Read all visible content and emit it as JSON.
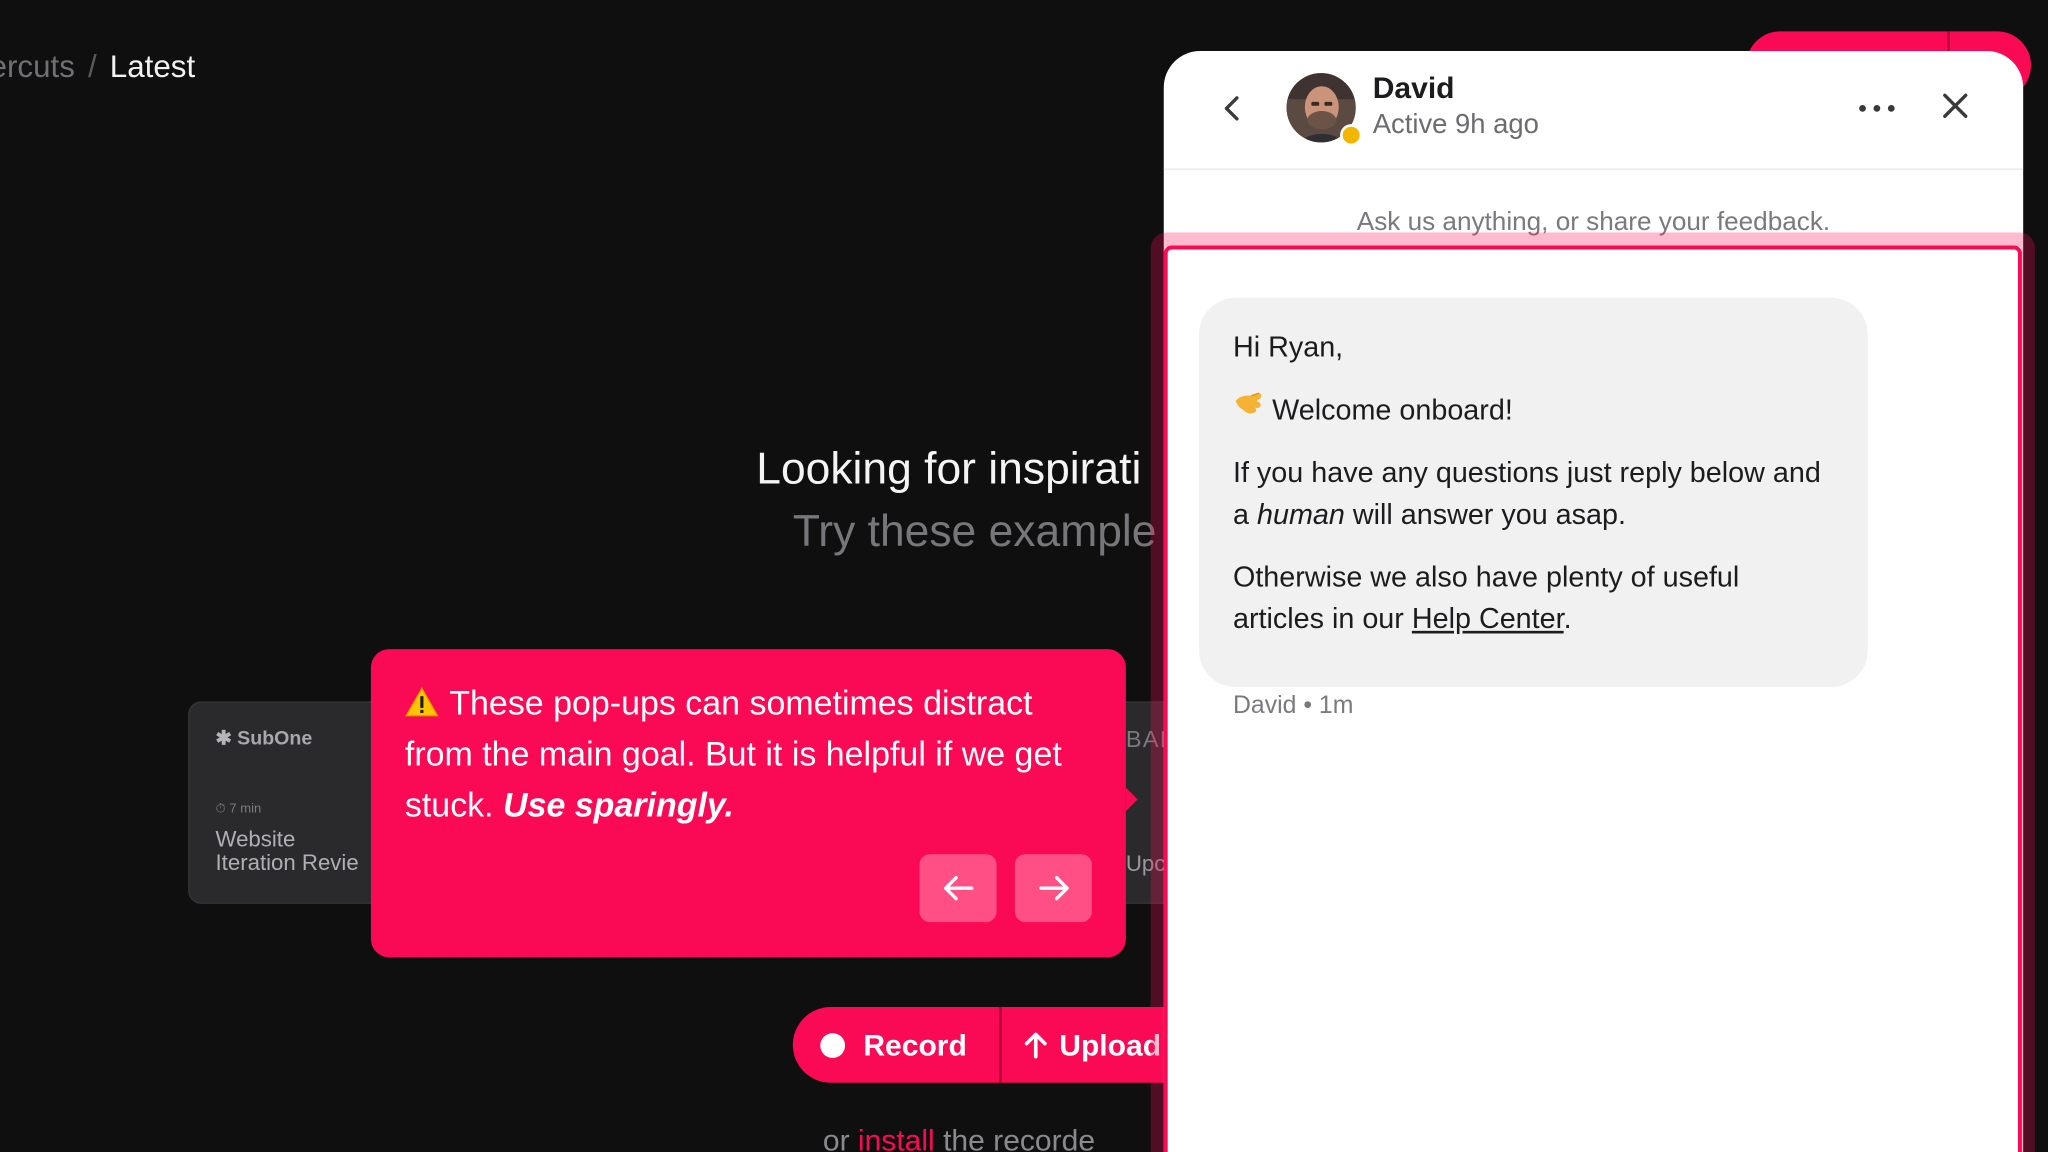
{
  "breadcrumb": {
    "parent": "ercuts",
    "separator": "/",
    "current": "Latest"
  },
  "hero": {
    "title": "Looking for inspirati",
    "subtitle": "Try these example"
  },
  "cards": [
    {
      "logo": "SubOne",
      "meta": "⏱ 7 min",
      "name_line1": "Website",
      "name_line2": "Iteration Revie"
    },
    {
      "badge": "BAE",
      "name": "Upc"
    }
  ],
  "tooltip": {
    "text_main": "These pop-ups can sometimes distract from the main goal. But it is helpful if we get stuck.",
    "text_emphasis": "Use sparingly.",
    "prev_icon": "arrow-left-icon",
    "next_icon": "arrow-right-icon"
  },
  "actions": {
    "record_label": "Record",
    "upload_label": "Upload",
    "install_prefix": "or",
    "install_link": "install",
    "install_suffix": "the recorde"
  },
  "chat": {
    "agent_name": "David",
    "agent_status": "Active 9h ago",
    "prompt": "Ask us anything, or share your feedback.",
    "message": {
      "greeting": "Hi Ryan,",
      "welcome": "Welcome onboard!",
      "line1_pre": "If you have any questions just reply below and a",
      "line1_em": "human",
      "line1_post": "will answer you asap.",
      "line2_pre": "Otherwise we also have plenty of useful articles in our",
      "line2_link": "Help Center",
      "line2_post": "."
    },
    "meta_author": "David",
    "meta_dot": "•",
    "meta_time": "1m"
  },
  "colors": {
    "accent": "#fa0a55",
    "background": "#0f0f10",
    "status_dot": "#f2b600"
  }
}
